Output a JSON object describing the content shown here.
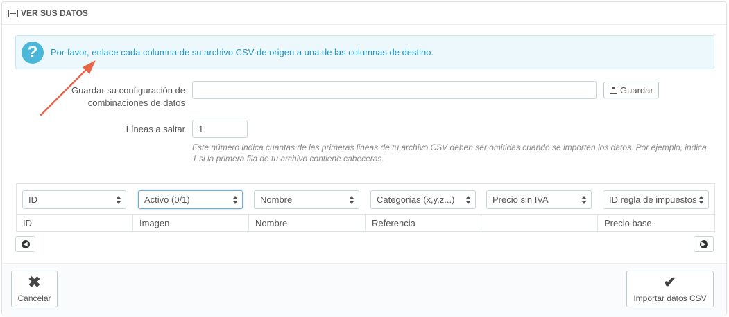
{
  "panel": {
    "title": "VER SUS DATOS"
  },
  "alert": {
    "message": "Por favor, enlace cada columna de su archivo CSV de origen a una de las columnas de destino."
  },
  "save_config": {
    "label_line1": "Guardar su configuración de",
    "label_line2": "combinaciones de datos",
    "value": "",
    "button_label": "Guardar"
  },
  "skip_lines": {
    "label": "Líneas a saltar",
    "value": "1",
    "help": "Este número indica cuantas de las primeras lineas de tu archivo CSV deben ser omitidas cuando se importen los datos. Por ejemplo, indica 1 si la primera fila de tu archivo contiene cabeceras."
  },
  "mapping": {
    "selects": [
      "ID",
      "Activo (0/1)",
      "Nombre",
      "Categorías (x,y,z...)",
      "Precio sin IVA",
      "ID regla de impuestos"
    ],
    "columns": [
      "ID",
      "Imagen",
      "Nombre",
      "Referencia",
      "",
      "Precio base"
    ]
  },
  "footer": {
    "cancel_label": "Cancelar",
    "import_label": "Importar datos CSV"
  },
  "colors": {
    "accent": "#4ab6d8",
    "arrow": "#e8654a",
    "alert_bg": "#ecf8fc"
  }
}
